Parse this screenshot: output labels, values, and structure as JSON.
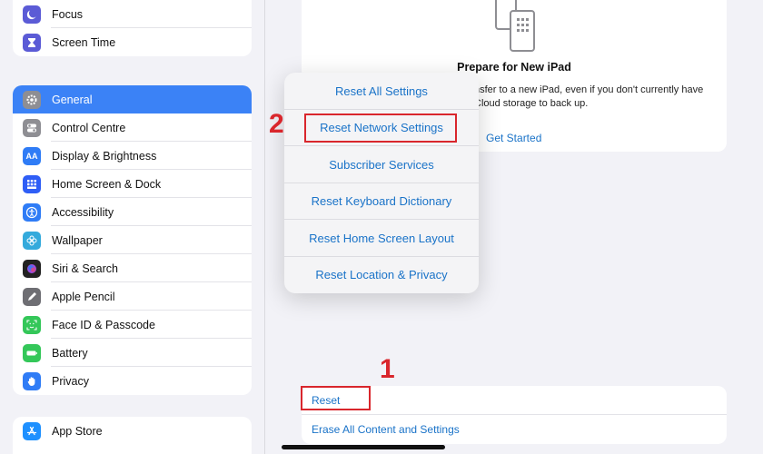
{
  "sidebar": {
    "group1": [
      {
        "label": "Focus",
        "icon": "moon-icon",
        "color": "#5b5bd6"
      },
      {
        "label": "Screen Time",
        "icon": "hourglass-icon",
        "color": "#5b5bd6"
      }
    ],
    "group2": [
      {
        "label": "General",
        "icon": "gear-icon",
        "color": "#8e8e93",
        "selected": true
      },
      {
        "label": "Control Centre",
        "icon": "toggles-icon",
        "color": "#8e8e93"
      },
      {
        "label": "Display & Brightness",
        "icon": "text-size-icon",
        "color": "#2f7cf6"
      },
      {
        "label": "Home Screen & Dock",
        "icon": "grid-icon",
        "color": "#2f5ef6"
      },
      {
        "label": "Accessibility",
        "icon": "accessibility-icon",
        "color": "#2f7cf6"
      },
      {
        "label": "Wallpaper",
        "icon": "flower-icon",
        "color": "#34aadc"
      },
      {
        "label": "Siri & Search",
        "icon": "siri-icon",
        "color": "#222222"
      },
      {
        "label": "Apple Pencil",
        "icon": "pencil-icon",
        "color": "#6e6e73"
      },
      {
        "label": "Face ID & Passcode",
        "icon": "face-id-icon",
        "color": "#34c759"
      },
      {
        "label": "Battery",
        "icon": "battery-icon",
        "color": "#34c759"
      },
      {
        "label": "Privacy",
        "icon": "hand-icon",
        "color": "#2f7cf6"
      }
    ],
    "group3": [
      {
        "label": "App Store",
        "icon": "app-store-icon",
        "color": "#1e90ff"
      }
    ]
  },
  "prepare": {
    "title": "Prepare for New iPad",
    "desc_line1": "nsfer to a new iPad, even if you don't currently have",
    "desc_line2": "Cloud storage to back up.",
    "link": "Get Started"
  },
  "popup": {
    "items": [
      "Reset All Settings",
      "Reset Network Settings",
      "Subscriber Services",
      "Reset Keyboard Dictionary",
      "Reset Home Screen Layout",
      "Reset Location & Privacy"
    ]
  },
  "bottom": {
    "reset": "Reset",
    "erase": "Erase All Content and Settings"
  },
  "annotations": {
    "step1": "1",
    "step2": "2"
  },
  "colors": {
    "accent": "#1a73c8",
    "highlight": "#d9262c",
    "selected": "#3b82f6"
  }
}
